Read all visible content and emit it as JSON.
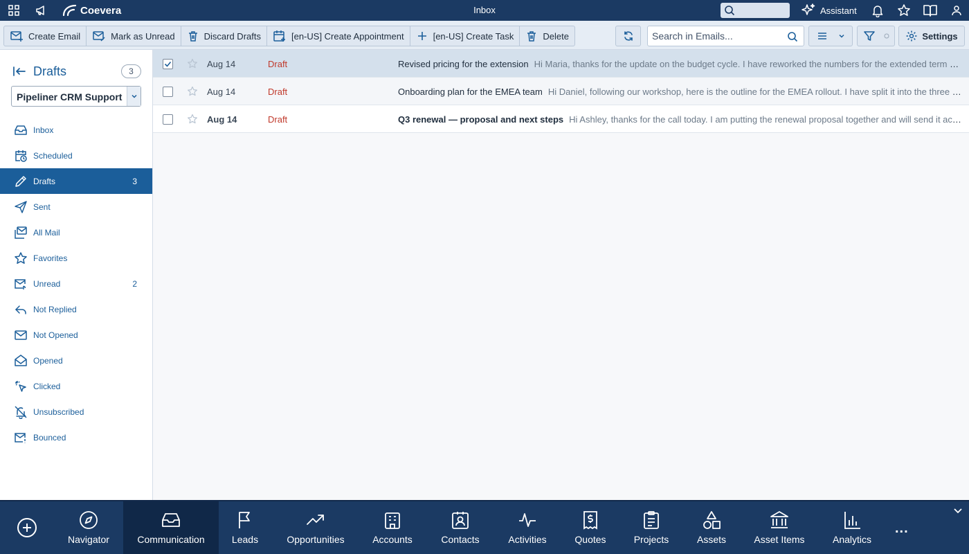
{
  "app": {
    "brand": "Coevera",
    "window_title": "Inbox"
  },
  "topbar": {
    "assistant_label": "Assistant"
  },
  "toolbar": {
    "create_email": "Create Email",
    "mark_unread": "Mark as Unread",
    "discard_drafts": "Discard Drafts",
    "create_appointment": "[en-US] Create Appointment",
    "create_task": "[en-US] Create Task",
    "delete": "Delete",
    "search_placeholder": "Search in Emails...",
    "settings": "Settings"
  },
  "sidebar": {
    "title": "Drafts",
    "count": "3",
    "account": "Pipeliner CRM Support",
    "items": [
      {
        "label": "Inbox",
        "count": "",
        "icon": "inbox-icon"
      },
      {
        "label": "Scheduled",
        "count": "",
        "icon": "calendar-clock-icon"
      },
      {
        "label": "Drafts",
        "count": "3",
        "icon": "pencil-icon"
      },
      {
        "label": "Sent",
        "count": "",
        "icon": "send-icon"
      },
      {
        "label": "All Mail",
        "count": "",
        "icon": "all-mail-icon"
      },
      {
        "label": "Favorites",
        "count": "",
        "icon": "star-icon"
      },
      {
        "label": "Unread",
        "count": "2",
        "icon": "mail-unread-icon"
      },
      {
        "label": "Not Replied",
        "count": "",
        "icon": "reply-icon"
      },
      {
        "label": "Not Opened",
        "count": "",
        "icon": "mail-closed-icon"
      },
      {
        "label": "Opened",
        "count": "",
        "icon": "mail-open-icon"
      },
      {
        "label": "Clicked",
        "count": "",
        "icon": "cursor-click-icon"
      },
      {
        "label": "Unsubscribed",
        "count": "",
        "icon": "bell-off-icon"
      },
      {
        "label": "Bounced",
        "count": "",
        "icon": "mail-bounced-icon"
      }
    ]
  },
  "emails": [
    {
      "date": "Aug 14",
      "status": "Draft",
      "subject": "Revised pricing for the extension",
      "preview": "Hi Maria, thanks for the update on the budget cycle. I have reworked the numbers for the extended term and attached the revised quote for your review.",
      "selected": true,
      "unread": false,
      "checked": true
    },
    {
      "date": "Aug 14",
      "status": "Draft",
      "subject": "Onboarding plan for the EMEA team",
      "preview": "Hi Daniel, following our workshop, here is the outline for the EMEA rollout. I have split it into the three phases we discussed.",
      "selected": false,
      "unread": false,
      "checked": false
    },
    {
      "date": "Aug 14",
      "status": "Draft",
      "subject": "Q3 renewal — proposal and next steps",
      "preview": "Hi Ashley, thanks for the call today. I am putting the renewal proposal together and will send it across by Friday.",
      "selected": false,
      "unread": true,
      "checked": false
    }
  ],
  "bottom_nav": {
    "items": [
      {
        "label": "Navigator",
        "icon": "compass-icon"
      },
      {
        "label": "Communication",
        "icon": "inbox-tray-icon"
      },
      {
        "label": "Leads",
        "icon": "flag-icon"
      },
      {
        "label": "Opportunities",
        "icon": "trend-up-icon"
      },
      {
        "label": "Accounts",
        "icon": "building-icon"
      },
      {
        "label": "Contacts",
        "icon": "contact-card-icon"
      },
      {
        "label": "Activities",
        "icon": "pulse-icon"
      },
      {
        "label": "Quotes",
        "icon": "dollar-doc-icon"
      },
      {
        "label": "Projects",
        "icon": "clipboard-icon"
      },
      {
        "label": "Assets",
        "icon": "shapes-icon"
      },
      {
        "label": "Asset Items",
        "icon": "bank-icon"
      },
      {
        "label": "Analytics",
        "icon": "bar-chart-icon"
      }
    ],
    "active": "Communication",
    "more": "..."
  },
  "colors": {
    "header": "#1b3a63",
    "accent": "#1b5e9a",
    "draft": "#c0392b"
  }
}
